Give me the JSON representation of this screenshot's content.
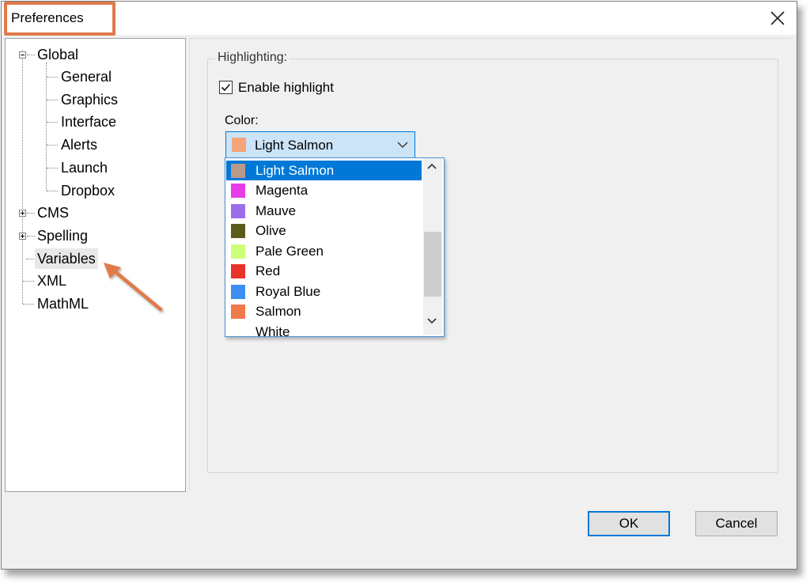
{
  "window": {
    "title": "Preferences"
  },
  "tree": {
    "items": [
      {
        "label": "Global"
      },
      {
        "label": "General"
      },
      {
        "label": "Graphics"
      },
      {
        "label": "Interface"
      },
      {
        "label": "Alerts"
      },
      {
        "label": "Launch"
      },
      {
        "label": "Dropbox"
      },
      {
        "label": "CMS"
      },
      {
        "label": "Spelling"
      },
      {
        "label": "Variables"
      },
      {
        "label": "XML"
      },
      {
        "label": "MathML"
      }
    ]
  },
  "highlighting": {
    "legend": "Highlighting:",
    "enable_label": "Enable highlight",
    "enable_checked": true,
    "color_label": "Color:",
    "selected_color": "Light Salmon",
    "selected_swatch": "#f4a57a"
  },
  "dropdown": {
    "options": [
      {
        "label": "Light Salmon",
        "color": "#b89a8a"
      },
      {
        "label": "Magenta",
        "color": "#e93ce9"
      },
      {
        "label": "Mauve",
        "color": "#9b6ee8"
      },
      {
        "label": "Olive",
        "color": "#5b5c1c"
      },
      {
        "label": "Pale Green",
        "color": "#cdff7a"
      },
      {
        "label": "Red",
        "color": "#e8332a"
      },
      {
        "label": "Royal Blue",
        "color": "#3d8ef2"
      },
      {
        "label": "Salmon",
        "color": "#ef7a4a"
      },
      {
        "label": "White",
        "color": "#ffffff"
      }
    ]
  },
  "buttons": {
    "ok": "OK",
    "cancel": "Cancel"
  }
}
